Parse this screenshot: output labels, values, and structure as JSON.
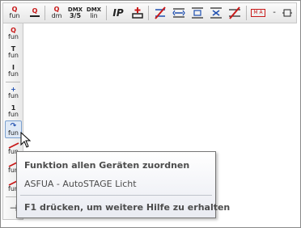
{
  "toolbar": {
    "buttons": [
      {
        "top": "Q",
        "bottom": "fun"
      },
      {
        "top": "Q",
        "bottom": ""
      },
      {
        "top": "Q",
        "bottom": "dm"
      },
      {
        "top": "DMX",
        "bottom": "3/5"
      },
      {
        "top": "DMX",
        "bottom": "lin"
      },
      {
        "top": "IP",
        "bottom": ""
      },
      {
        "top": "+",
        "bottom": ""
      },
      {
        "top": "",
        "bottom": ""
      },
      {
        "top": "",
        "bottom": ""
      },
      {
        "top": "",
        "bottom": ""
      },
      {
        "top": "",
        "bottom": ""
      },
      {
        "top": "",
        "bottom": ""
      },
      {
        "top": "M A",
        "bottom": ""
      },
      {
        "top": "-",
        "bottom": ""
      },
      {
        "top": "¤",
        "bottom": ""
      }
    ]
  },
  "sidebar": {
    "buttons": [
      {
        "top": "Q",
        "bottom": "fun"
      },
      {
        "top": "T",
        "bottom": "fun"
      },
      {
        "top": "I",
        "bottom": "fun"
      },
      {
        "top": "+",
        "bottom": "fun"
      },
      {
        "top": "1",
        "bottom": "fun"
      },
      {
        "top": "↷",
        "bottom": "fun"
      },
      {
        "top": "",
        "bottom": "fun"
      },
      {
        "top": "",
        "bottom": "fun"
      },
      {
        "top": "",
        "bottom": "fun"
      },
      {
        "top": "⊣",
        "bottom": ""
      }
    ]
  },
  "tooltip": {
    "title": "Funktion allen Geräten zuordnen",
    "description": "ASFUA - AutoSTAGE Licht",
    "footer": "F1 drücken, um weitere Hilfe zu erhalten"
  },
  "colors": {
    "accent_red": "#c81818",
    "accent_blue": "#1f4fb0",
    "tooltip_border": "#767676"
  }
}
